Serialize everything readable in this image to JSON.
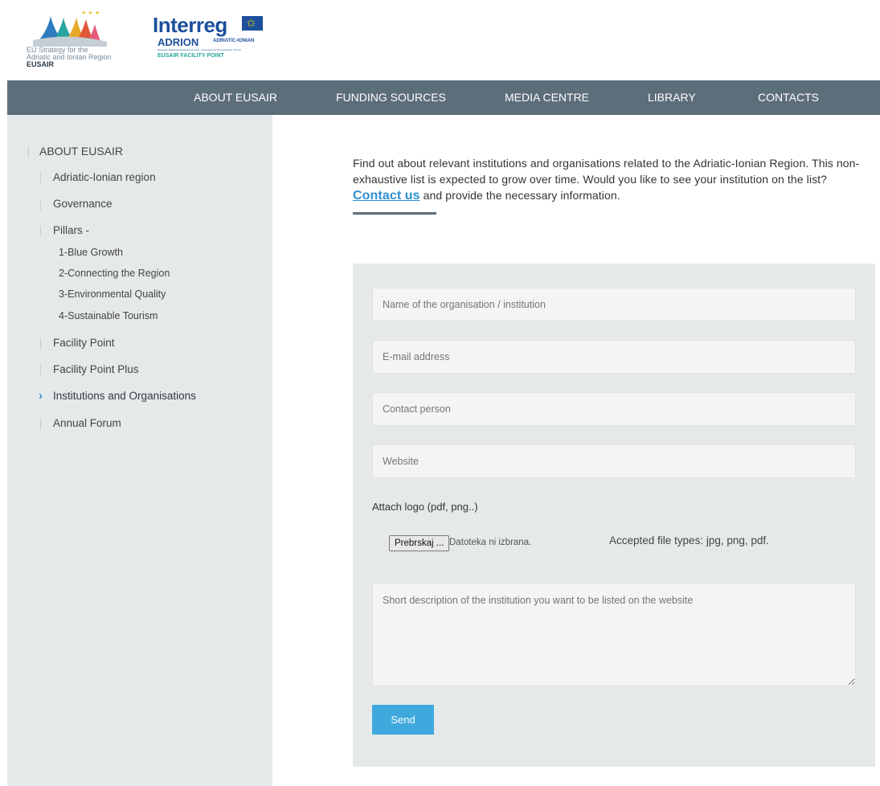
{
  "header": {
    "eusair_logo": {
      "line1": "EU Strategy for the",
      "line2": "Adriatic and Ionian Region",
      "line3": "EUSAIR"
    },
    "interreg_logo": {
      "name": "Interreg",
      "program": "ADRION",
      "program_sub": "ADRIATIC-IONIAN",
      "fine_print": "European Regional Development Fund · Instrument for Pre-Accession II Fund",
      "facility": "EUSAIR FACILITY POINT"
    }
  },
  "nav": {
    "items": [
      "ABOUT EUSAIR",
      "FUNDING SOURCES",
      "MEDIA CENTRE",
      "LIBRARY",
      "CONTACTS"
    ]
  },
  "sidebar": {
    "section_title": "ABOUT EUSAIR",
    "items": [
      "Adriatic-Ionian region",
      "Governance",
      "Pillars -",
      "Facility Point",
      "Facility Point Plus",
      "Institutions and Organisations",
      "Annual Forum"
    ],
    "pillars": [
      "1-Blue Growth",
      "2-Connecting the Region",
      "3-Environmental Quality",
      "4-Sustainable Tourism"
    ],
    "active_item": "Institutions and Organisations"
  },
  "main": {
    "intro_before": "Find out about relevant institutions and organisations related to the Adriatic-Ionian Region. This non-exhaustive list is expected to grow over time. Would you like to see your institution on the list? ",
    "intro_link": "Contact us",
    "intro_after": " and provide the necessary information."
  },
  "form": {
    "name_placeholder": "Name of the organisation / institution",
    "email_placeholder": "E-mail address",
    "contact_placeholder": "Contact person",
    "website_placeholder": "Website",
    "attach_label": "Attach logo (pdf, png..)",
    "file_button": "Prebrskaj ...",
    "file_status": "Datoteka ni izbrana.",
    "accepted_types": "Accepted file types: jpg, png, pdf.",
    "description_placeholder": "Short description of the institution you want to be listed on the website",
    "send_label": "Send"
  },
  "colors": {
    "nav_bg": "#5d6e7b",
    "panel_bg": "#e6e9ea",
    "accent": "#3fa9dd",
    "link": "#2d8fd0"
  }
}
